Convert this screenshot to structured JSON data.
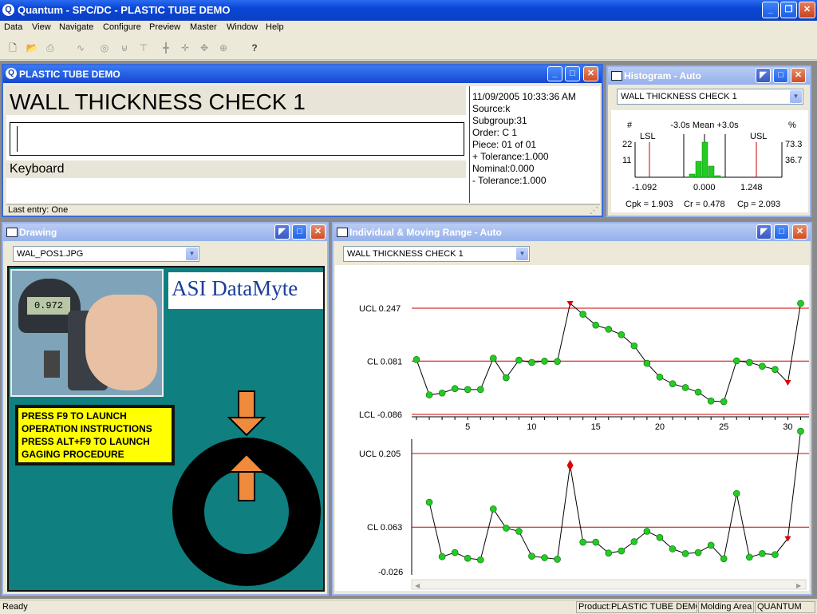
{
  "app": {
    "title": "Quantum - SPC/DC - PLASTIC TUBE DEMO",
    "logo_letter": "Q",
    "menu": [
      "Data",
      "View",
      "Navigate",
      "Configure",
      "Preview",
      "Master",
      "Window",
      "Help"
    ]
  },
  "toolbar": {
    "icons": [
      "new-file-icon",
      "open-folder-icon",
      "print-icon",
      "chart-icon",
      "gauge-icon",
      "cup-icon",
      "tree-icon",
      "axis-icon",
      "cross-icon",
      "ring-icon",
      "help-icon"
    ]
  },
  "data_window": {
    "title": "PLASTIC TUBE DEMO",
    "characteristic": "WALL THICKNESS CHECK 1",
    "input_value": "",
    "input_mode": "Keyboard",
    "last_entry": "Last entry: One",
    "info": [
      "11/09/2005 10:33:36 AM",
      "Source:k",
      "Subgroup:31",
      "Order: C 1",
      "Piece: 01 of 01",
      "+ Tolerance:1.000",
      "Nominal:0.000",
      "- Tolerance:1.000"
    ]
  },
  "histogram": {
    "title": "Histogram - Auto",
    "combo": "WALL THICKNESS CHECK 1",
    "count_label": "#",
    "pct_label": "%",
    "header": "-3.0s Mean +3.0s",
    "lsl": "LSL",
    "usl": "USL",
    "y_left": [
      "22",
      "11"
    ],
    "y_right": [
      "73.3",
      "36.7"
    ],
    "x_labels": [
      "-1.092",
      "0.000",
      "1.248"
    ],
    "stats": [
      "Cpk = 1.903",
      "Cr = 0.478",
      "Cp = 2.093"
    ],
    "bins": [
      2,
      10,
      22,
      7,
      1
    ]
  },
  "drawing": {
    "title": "Drawing",
    "combo": "WAL_POS1.JPG",
    "brand": "ASI DataMyte",
    "gauge_display": "0.972",
    "instructions": [
      "PRESS F9 TO LAUNCH",
      "OPERATION INSTRUCTIONS",
      "PRESS ALT+F9 TO LAUNCH",
      "GAGING PROCEDURE"
    ]
  },
  "control_chart": {
    "title": "Individual & Moving Range - Auto",
    "combo": "WALL THICKNESS CHECK 1",
    "individual": {
      "ucl_label": "UCL 0.247",
      "cl_label": "CL 0.081",
      "lcl_label": "LCL -0.086",
      "ucl": 0.247,
      "cl": 0.081,
      "lcl": -0.086
    },
    "moving_range": {
      "ucl_label": "UCL 0.205",
      "cl_label": "CL 0.063",
      "bottom_label": "-0.026",
      "ucl": 0.205,
      "cl": 0.063
    },
    "x_ticks": [
      "5",
      "10",
      "15",
      "20",
      "25",
      "30"
    ]
  },
  "status": {
    "ready": "Ready",
    "product": "Product:PLASTIC TUBE DEMO",
    "area": "Molding Area",
    "user": "QUANTUM"
  },
  "colors": {
    "control_line": "#cc0000",
    "point": "#22cc22",
    "out_of_control": "#dd0000",
    "histogram_bar": "#22cc22",
    "drawing_bg": "#0f7f7f"
  },
  "chart_data": [
    {
      "type": "line",
      "title": "Individual",
      "x": [
        1,
        2,
        3,
        4,
        5,
        6,
        7,
        8,
        9,
        10,
        11,
        12,
        13,
        14,
        15,
        16,
        17,
        18,
        19,
        20,
        21,
        22,
        23,
        24,
        25,
        26,
        27,
        28,
        29,
        30
      ],
      "series": [
        {
          "values": [
            0.086,
            -0.025,
            -0.019,
            -0.005,
            -0.008,
            -0.008,
            0.09,
            0.029,
            0.084,
            0.077,
            0.081,
            0.08,
            0.262,
            0.228,
            0.194,
            0.181,
            0.164,
            0.129,
            0.074,
            0.031,
            0.01,
            -0.002,
            -0.016,
            -0.044,
            -0.046,
            0.082,
            0.077,
            0.065,
            0.055,
            0.014,
            0.262
          ]
        }
      ],
      "ucl": 0.247,
      "cl": 0.081,
      "lcl": -0.086,
      "out_of_control": [
        13,
        30
      ]
    },
    {
      "type": "line",
      "title": "Moving Range",
      "x": [
        2,
        3,
        4,
        5,
        6,
        7,
        8,
        9,
        10,
        11,
        12,
        13,
        14,
        15,
        16,
        17,
        18,
        19,
        20,
        21,
        22,
        23,
        24,
        25,
        26,
        27,
        28,
        29,
        30
      ],
      "series": [
        {
          "values": [
            0.111,
            0.006,
            0.014,
            0.003,
            0.0,
            0.098,
            0.061,
            0.055,
            0.007,
            0.004,
            0.001,
            0.182,
            0.034,
            0.034,
            0.013,
            0.017,
            0.035,
            0.055,
            0.043,
            0.021,
            0.012,
            0.014,
            0.028,
            0.002,
            0.128,
            0.005,
            0.012,
            0.01,
            0.041,
            0.248
          ]
        }
      ],
      "ucl": 0.205,
      "cl": 0.063,
      "out_of_control": [
        13,
        30
      ]
    },
    {
      "type": "bar",
      "title": "Histogram - Auto",
      "values": [
        2,
        10,
        22,
        7,
        1
      ],
      "lsl": -1.092,
      "usl": 1.248,
      "mean": 0.0
    }
  ]
}
